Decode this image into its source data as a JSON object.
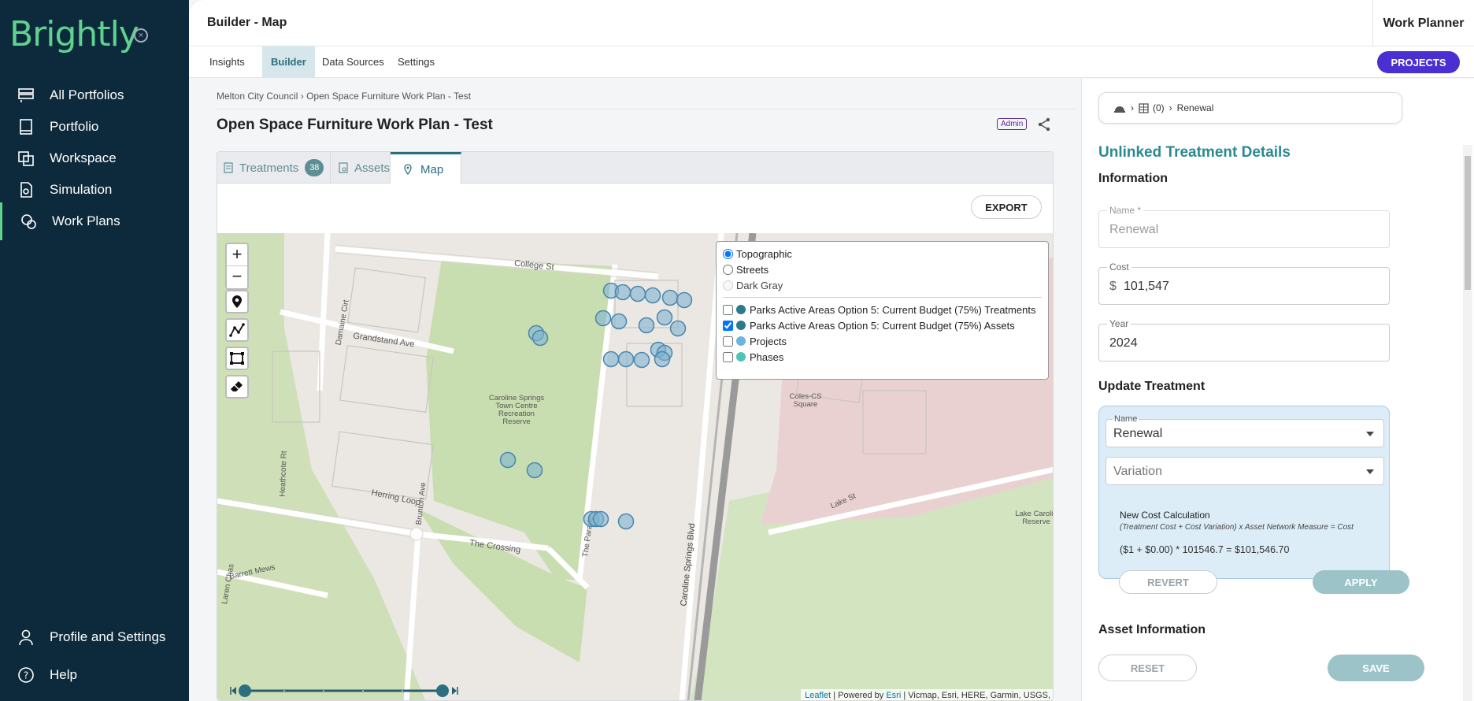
{
  "brand": {
    "name": "Brightly"
  },
  "sidebar": {
    "items": [
      {
        "label": "All Portfolios",
        "icon": "portfolios-icon"
      },
      {
        "label": "Portfolio",
        "icon": "book-icon"
      },
      {
        "label": "Workspace",
        "icon": "workspace-icon"
      },
      {
        "label": "Simulation",
        "icon": "simulation-icon"
      },
      {
        "label": "Work Plans",
        "icon": "work-plans-icon",
        "active": true
      }
    ],
    "bottom_items": [
      {
        "label": "Profile and Settings",
        "icon": "user-icon"
      },
      {
        "label": "Help",
        "icon": "help-icon"
      }
    ]
  },
  "header": {
    "title": "Builder - Map",
    "right_label": "Work Planner"
  },
  "subnav": {
    "tabs": [
      {
        "label": "Insights"
      },
      {
        "label": "Builder",
        "active": true
      },
      {
        "label": "Data Sources"
      },
      {
        "label": "Settings"
      }
    ],
    "projects_button": "PROJECTS"
  },
  "breadcrumb": {
    "parent": "Melton City Council",
    "current": "Open Space Furniture Work Plan - Test"
  },
  "plan": {
    "title": "Open Space Furniture Work Plan - Test",
    "role_badge": "Admin"
  },
  "content_tabs": [
    {
      "label": "Treatments",
      "count": "38"
    },
    {
      "label": "Assets"
    },
    {
      "label": "Map",
      "active": true
    }
  ],
  "export_button": "EXPORT",
  "map": {
    "basemaps": [
      {
        "label": "Topographic",
        "selected": true
      },
      {
        "label": "Streets",
        "selected": false
      },
      {
        "label": "Dark Gray",
        "selected": false,
        "disabled": true
      }
    ],
    "layers": [
      {
        "label": "Parks Active Areas Option 5: Current Budget (75%) Treatments",
        "checked": false,
        "color": "#2b7a8c"
      },
      {
        "label": "Parks Active Areas Option 5: Current Budget (75%) Assets",
        "checked": true,
        "color": "#2b7a8c"
      },
      {
        "label": "Projects",
        "checked": false,
        "color": "#6fb3e0"
      },
      {
        "label": "Phases",
        "checked": false,
        "color": "#4fc3b5"
      }
    ],
    "street_labels": {
      "college": "College St",
      "grandstand": "Grandstand Ave",
      "damaine": "Damaine Cirt",
      "heathcote": "Heathcote Rt",
      "herring": "Herring Loop",
      "brunton": "Brunton Ave",
      "crossing": "The Crossing",
      "parade": "The Parade",
      "csblvd": "Caroline Springs Blvd",
      "lake": "Lake St",
      "barrett": "Barrett Mews",
      "laren": "Laren Chas"
    },
    "place_labels": {
      "reserve": [
        "Caroline Springs",
        "Town Centre",
        "Recreation",
        "Reserve"
      ],
      "coles": [
        "Coles-CS",
        "Square"
      ],
      "lake_reserve": [
        "Lake Carolin",
        "Reserve"
      ]
    },
    "attribution": {
      "leaflet": "Leaflet",
      "powered": "| Powered by",
      "esri": "Esri",
      "rest": "| Vicmap, Esri, HERE, Garmin, USGS,"
    }
  },
  "detail": {
    "breadcrumb_count": "(0)",
    "breadcrumb_label": "Renewal",
    "title": "Unlinked Treatment Details",
    "info_heading": "Information",
    "name_label": "Name *",
    "name_value": "Renewal",
    "cost_label": "Cost",
    "cost_prefix": "$",
    "cost_value": "101,547",
    "year_label": "Year",
    "year_value": "2024",
    "update_heading": "Update Treatment",
    "treatment_name_label": "Name",
    "treatment_name_value": "Renewal",
    "variation_placeholder": "Variation",
    "calc_title": "New Cost Calculation",
    "calc_formula": "(Treatment Cost + Cost Variation) x Asset Network Measure = Cost",
    "calc_result": "($1 + $0.00) * 101546.7 = $101,546.70",
    "revert_button": "REVERT",
    "apply_button": "APPLY",
    "asset_heading": "Asset Information",
    "reset_button": "RESET",
    "save_button": "SAVE"
  }
}
